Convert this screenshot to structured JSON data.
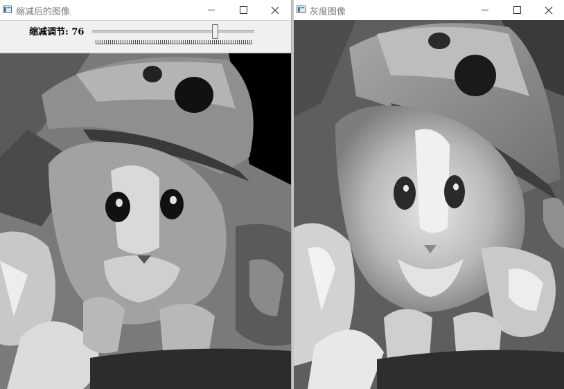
{
  "windows": {
    "reduced": {
      "title": "缩减后的图像",
      "slider": {
        "label": "缩减调节: 76",
        "value": 76,
        "max": 100
      }
    },
    "gray": {
      "title": "灰度图像"
    }
  },
  "icons": {
    "app": "window-app-icon",
    "minimize": "minimize-icon",
    "maximize": "maximize-icon",
    "close": "close-icon"
  },
  "colors": {
    "titlebar_bg": "#ffffff",
    "title_text": "#7a7a7a",
    "control_panel_bg": "#f0f0f0"
  }
}
